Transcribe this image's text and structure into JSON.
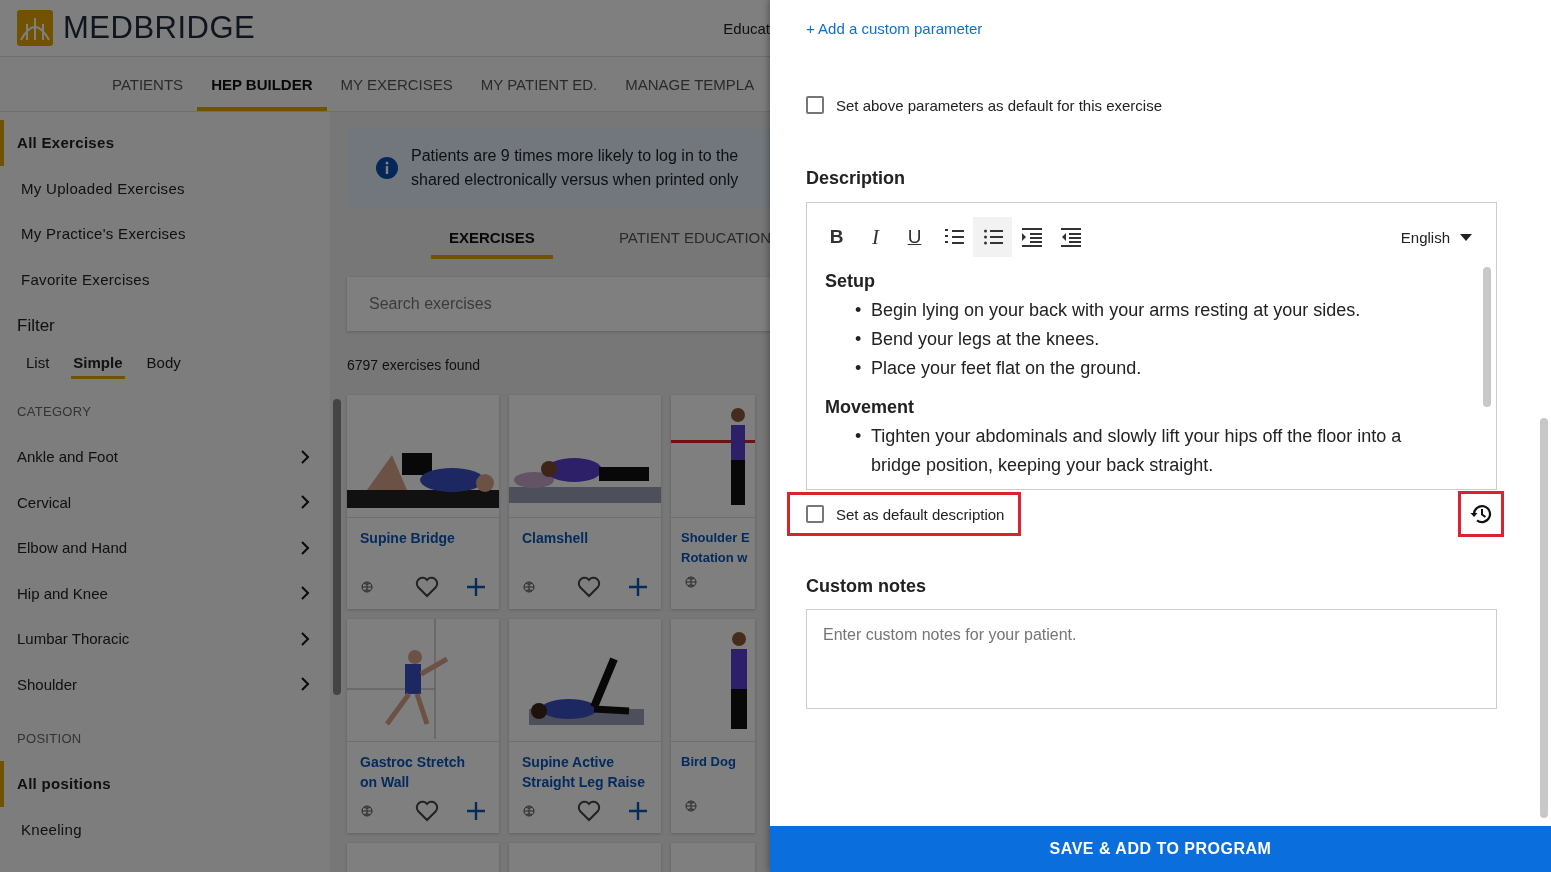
{
  "header": {
    "logo": "MEDBRIDGE",
    "menu_text": "Educat"
  },
  "nav_tabs": [
    {
      "label": "PATIENTS",
      "selected": false
    },
    {
      "label": "HEP BUILDER",
      "selected": true
    },
    {
      "label": "MY EXERCISES",
      "selected": false
    },
    {
      "label": "MY PATIENT ED.",
      "selected": false
    },
    {
      "label": "MANAGE TEMPLA",
      "selected": false
    }
  ],
  "sidebar": {
    "items": [
      {
        "label": "All Exercises",
        "selected": true
      },
      {
        "label": "My Uploaded Exercises",
        "selected": false
      },
      {
        "label": "My Practice's Exercises",
        "selected": false
      },
      {
        "label": "Favorite Exercises",
        "selected": false
      }
    ],
    "filter_title": "Filter",
    "filter_tabs": [
      {
        "label": "List",
        "selected": false
      },
      {
        "label": "Simple",
        "selected": true
      },
      {
        "label": "Body",
        "selected": false
      }
    ],
    "category_heading": "CATEGORY",
    "categories": [
      "Ankle and Foot",
      "Cervical",
      "Elbow and Hand",
      "Hip and Knee",
      "Lumbar Thoracic",
      "Shoulder"
    ],
    "position_heading": "POSITION",
    "positions": [
      {
        "label": "All positions",
        "selected": true
      },
      {
        "label": "Kneeling",
        "selected": false
      }
    ]
  },
  "main": {
    "banner": [
      "Patients are 9 times more likely to log in to the",
      "shared electronically versus when printed only"
    ],
    "tabs": [
      {
        "label": "EXERCISES",
        "selected": true
      },
      {
        "label": "PATIENT EDUCATION",
        "selected": false
      }
    ],
    "search": {
      "placeholder": "Search exercises"
    },
    "result_count": "6797 exercises found",
    "cards": [
      {
        "title": "Supine Bridge",
        "kind": "picture",
        "cut": false
      },
      {
        "title": "Clamshell",
        "kind": "picture",
        "cut": false
      },
      {
        "title": "Shoulder E Rotation w",
        "kind": "picture",
        "cut": true
      },
      {
        "title": "Gastroc Stretch on Wall",
        "kind": "picture",
        "cut": false
      },
      {
        "title": "Supine Active Straight Leg Raise",
        "kind": "picture",
        "cut": false
      },
      {
        "title": "Bird Dog",
        "kind": "picture",
        "cut": true
      }
    ]
  },
  "panel": {
    "add_link": "+ Add a custom parameter",
    "default_params": {
      "label": "Set above parameters as default for this exercise",
      "checked": false
    },
    "description_heading": "Description",
    "toolbar": [
      {
        "kind": "bold",
        "label": "B",
        "selected": false
      },
      {
        "kind": "italic",
        "label": "I",
        "selected": false
      },
      {
        "kind": "underline",
        "label": "U",
        "selected": false
      },
      {
        "kind": "numbered-list",
        "selected": false
      },
      {
        "kind": "bullet-list",
        "selected": true
      },
      {
        "kind": "indent",
        "selected": false
      },
      {
        "kind": "outdent",
        "selected": false
      }
    ],
    "language": "English",
    "sections": [
      {
        "heading": "Setup",
        "marker": "•",
        "bullets": [
          "Begin lying on your back with your arms resting at your sides.",
          "Bend your legs at the knees.",
          "Place your feet flat on the ground."
        ]
      },
      {
        "heading": "Movement",
        "marker": "•",
        "bullets": [
          "Tighten your abdominals and slowly lift your hips off the floor into a bridge position, keeping your back straight."
        ]
      }
    ],
    "default_description": {
      "label": "Set as default description",
      "checked": false,
      "highlighted": true
    },
    "history": {
      "highlighted": true
    },
    "notes_heading": "Custom notes",
    "notes": {
      "placeholder": "Enter custom notes for your patient."
    },
    "save_button": "SAVE & ADD TO PROGRAM"
  }
}
